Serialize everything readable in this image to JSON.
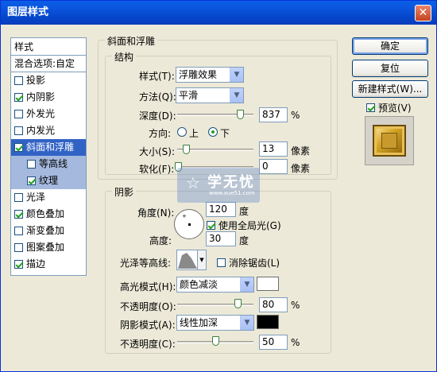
{
  "window": {
    "title": "图层样式",
    "close_glyph": "✕"
  },
  "style_list": {
    "header": "样式",
    "blend_options": "混合选项:自定",
    "items": [
      {
        "label": "投影",
        "checked": false
      },
      {
        "label": "内阴影",
        "checked": true
      },
      {
        "label": "外发光",
        "checked": false
      },
      {
        "label": "内发光",
        "checked": false
      },
      {
        "label": "斜面和浮雕",
        "checked": true,
        "selected": true
      },
      {
        "label": "等高线",
        "checked": false,
        "sub": true
      },
      {
        "label": "纹理",
        "checked": true,
        "sub": true
      },
      {
        "label": "光泽",
        "checked": false
      },
      {
        "label": "颜色叠加",
        "checked": true
      },
      {
        "label": "渐变叠加",
        "checked": false
      },
      {
        "label": "图案叠加",
        "checked": false
      },
      {
        "label": "描边",
        "checked": true
      }
    ]
  },
  "bevel": {
    "section_title": "斜面和浮雕",
    "structure_title": "结构",
    "style_label": "样式(T):",
    "style_value": "浮雕效果",
    "technique_label": "方法(Q):",
    "technique_value": "平滑",
    "depth_label": "深度(D):",
    "depth_value": "837",
    "depth_unit": "%",
    "direction_label": "方向:",
    "dir_up": "上",
    "dir_down": "下",
    "size_label": "大小(S):",
    "size_value": "13",
    "size_unit": "像素",
    "soften_label": "软化(F):",
    "soften_value": "0",
    "soften_unit": "像素"
  },
  "shading": {
    "title": "阴影",
    "angle_label": "角度(N):",
    "angle_value": "120",
    "angle_unit": "度",
    "global_light_label": "使用全局光(G)",
    "altitude_label": "高度:",
    "altitude_value": "30",
    "altitude_unit": "度",
    "gloss_label": "光泽等高线:",
    "antialias_label": "消除锯齿(L)",
    "highlight_mode_label": "高光模式(H):",
    "highlight_mode_value": "颜色减淡",
    "highlight_color": "#ffffff",
    "highlight_opacity_label": "不透明度(O):",
    "highlight_opacity_value": "80",
    "highlight_opacity_unit": "%",
    "shadow_mode_label": "阴影模式(A):",
    "shadow_mode_value": "线性加深",
    "shadow_color": "#000000",
    "shadow_opacity_label": "不透明度(C):",
    "shadow_opacity_value": "50",
    "shadow_opacity_unit": "%"
  },
  "buttons": {
    "ok": "确定",
    "reset": "复位",
    "new_style": "新建样式(W)...",
    "preview": "预览(V)"
  },
  "watermark": {
    "text": "学无忧",
    "url": "www.xue51.com"
  },
  "colors": {
    "titlebar": "#0a5fe8",
    "selection": "#3163c5",
    "dialog_bg": "#ece9d8"
  }
}
